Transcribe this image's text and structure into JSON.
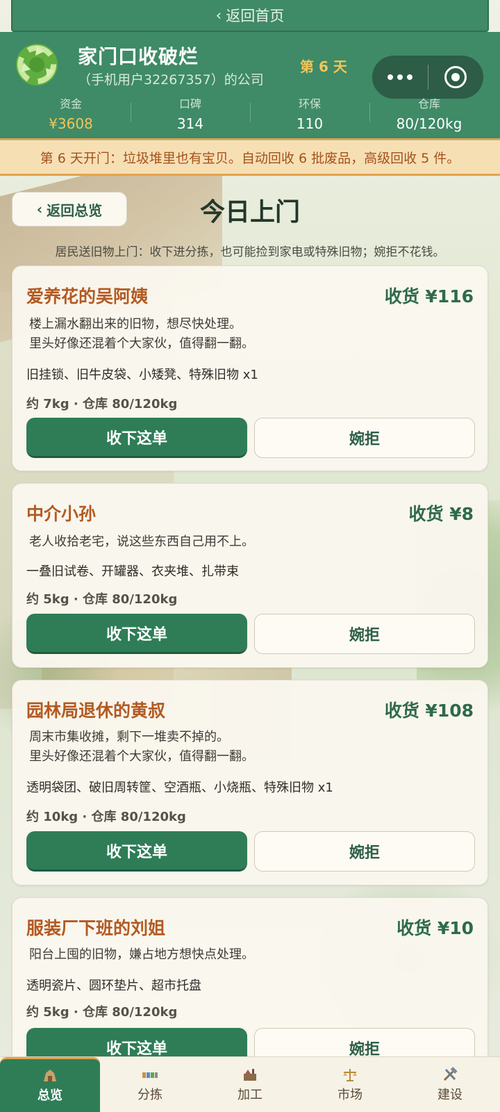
{
  "header": {
    "back_home": "返回首页",
    "company_name": "家门口收破烂",
    "owner": "（手机用户32267357）的公司",
    "day_label": "第 6 天",
    "stats": [
      {
        "label": "资金",
        "value": "¥3608"
      },
      {
        "label": "口碑",
        "value": "314"
      },
      {
        "label": "环保",
        "value": "110"
      },
      {
        "label": "仓库",
        "value": "80/120kg"
      }
    ]
  },
  "notice": "第 6 天开门：垃圾堆里也有宝贝。自动回收 6 批废品，高级回收 5 件。",
  "section": {
    "back_label": "返回总览",
    "title": "今日上门",
    "description": "居民送旧物上门：收下进分拣，也可能捡到家电或特殊旧物；婉拒不花钱。"
  },
  "cards": [
    {
      "name": "爱养花的吴阿姨",
      "price": "收货 ¥116",
      "desc1": "楼上漏水翻出来的旧物，想尽快处理。",
      "desc2": "里头好像还混着个大家伙，值得翻一翻。",
      "items": "旧挂锁、旧牛皮袋、小矮凳、特殊旧物 x1",
      "meta": "约 7kg · 仓库 80/120kg",
      "accept": "收下这单",
      "reject": "婉拒"
    },
    {
      "name": "中介小孙",
      "price": "收货 ¥8",
      "desc1": "老人收拾老宅，说这些东西自己用不上。",
      "items": "一叠旧试卷、开罐器、衣夹堆、扎带束",
      "meta": "约 5kg · 仓库 80/120kg",
      "accept": "收下这单",
      "reject": "婉拒"
    },
    {
      "name": "园林局退休的黄叔",
      "price": "收货 ¥108",
      "desc1": "周末市集收摊，剩下一堆卖不掉的。",
      "desc2": "里头好像还混着个大家伙，值得翻一翻。",
      "items": "透明袋团、破旧周转筐、空酒瓶、小烧瓶、特殊旧物 x1",
      "meta": "约 10kg · 仓库 80/120kg",
      "accept": "收下这单",
      "reject": "婉拒"
    },
    {
      "name": "服装厂下班的刘姐",
      "price": "收货 ¥10",
      "desc1": "阳台上囤的旧物，嫌占地方想快点处理。",
      "items": "透明瓷片、圆环垫片、超市托盘",
      "meta": "约 5kg · 仓库 80/120kg",
      "accept": "收下这单",
      "reject": "婉拒"
    }
  ],
  "nav": [
    {
      "label": "总览",
      "icon": "overview-icon"
    },
    {
      "label": "分拣",
      "icon": "sorting-icon"
    },
    {
      "label": "加工",
      "icon": "processing-icon"
    },
    {
      "label": "市场",
      "icon": "market-icon"
    },
    {
      "label": "建设",
      "icon": "build-icon"
    }
  ],
  "colors": {
    "header_green": "#3f8a67",
    "accent_orange": "#e7a24a",
    "money_gold": "#f3c558",
    "button_green": "#2e7d57",
    "name_brown": "#b35a22"
  }
}
